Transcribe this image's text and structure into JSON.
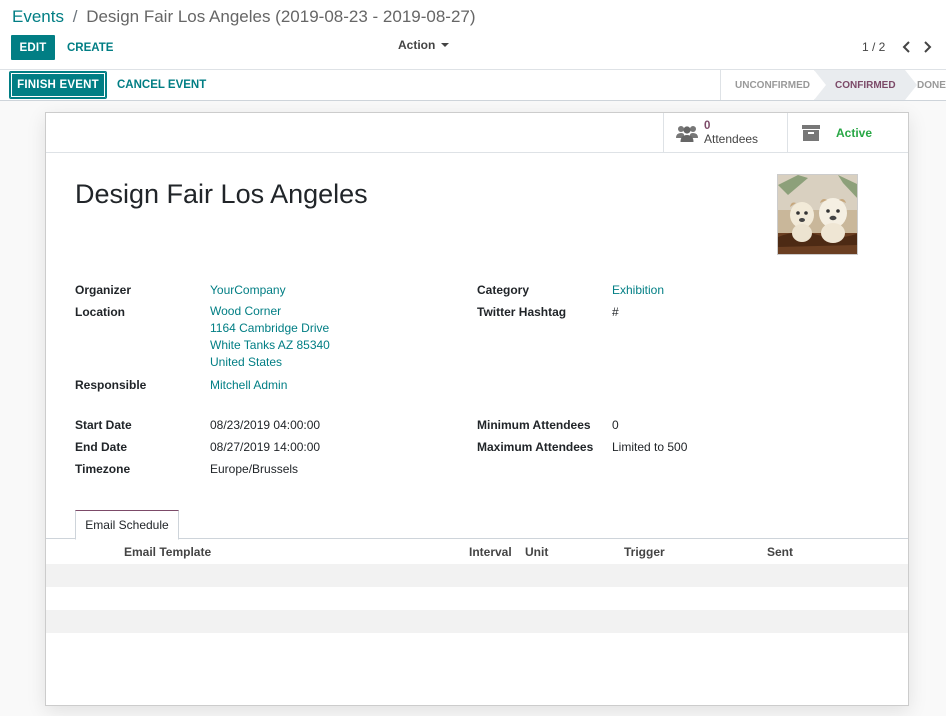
{
  "breadcrumb": {
    "parent": "Events",
    "separator": "/",
    "current": "Design Fair Los Angeles (2019-08-23 - 2019-08-27)"
  },
  "control_panel": {
    "edit_label": "EDIT",
    "create_label": "CREATE",
    "action_label": "Action",
    "pager_value": "1 / 2"
  },
  "statusbar": {
    "finish_label": "FINISH EVENT",
    "cancel_label": "CANCEL EVENT",
    "stages": [
      {
        "label": "UNCONFIRMED",
        "active": false
      },
      {
        "label": "CONFIRMED",
        "active": true
      },
      {
        "label": "DONE",
        "active": false
      }
    ]
  },
  "smart_buttons": {
    "attendees_count": "0",
    "attendees_label": "Attendees",
    "active_label": "Active"
  },
  "event": {
    "name": "Design Fair Los Angeles"
  },
  "fields": {
    "organizer_label": "Organizer",
    "organizer": "YourCompany",
    "location_label": "Location",
    "location_lines": [
      "Wood Corner",
      "1164 Cambridge Drive",
      "White Tanks AZ 85340",
      "United States"
    ],
    "responsible_label": "Responsible",
    "responsible": "Mitchell Admin",
    "category_label": "Category",
    "category": "Exhibition",
    "hashtag_label": "Twitter Hashtag",
    "hashtag": "#",
    "start_date_label": "Start Date",
    "start_date": "08/23/2019 04:00:00",
    "end_date_label": "End Date",
    "end_date": "08/27/2019 14:00:00",
    "timezone_label": "Timezone",
    "timezone": "Europe/Brussels",
    "min_attendees_label": "Minimum Attendees",
    "min_attendees": "0",
    "max_attendees_label": "Maximum Attendees",
    "max_attendees": "Limited to 500"
  },
  "notebook": {
    "tab_label": "Email Schedule",
    "columns": [
      "Email Template",
      "Interval",
      "Unit",
      "Trigger",
      "Sent"
    ]
  },
  "colors": {
    "primary": "#017e84",
    "accent": "#7c4a68",
    "success": "#28a745"
  }
}
